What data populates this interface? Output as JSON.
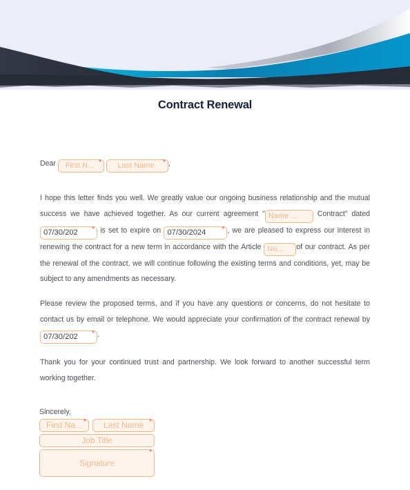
{
  "document": {
    "title": "Contract Renewal",
    "greeting": {
      "prefix": "Dear",
      "first_name_placeholder": "First N...",
      "last_name_placeholder": "Last Name",
      "suffix": ","
    },
    "paragraph1": {
      "text_a": "I hope this letter finds you well. We greatly value our ongoing business relationship and the mutual success we have achieved together. As our current agreement \"",
      "agreement_name_placeholder": "Name ...",
      "text_b": "Contract\" dated",
      "dated_value": "07/30/202",
      "text_c": "is set to expire on",
      "expire_value": "07/30/2024",
      "text_d": ", we are pleased to express our interest in renewing the contract for a new term in accordance with the Article",
      "article_placeholder": "Nu...",
      "text_e": "of our contract. As per the renewal of the contract, we will continue following the existing terms and conditions, yet, may be subject to any amendments as necessary."
    },
    "paragraph2": {
      "text_a": "Please review the proposed terms, and if you have any questions or concerns, do not hesitate to contact us by email or telephone. We would appreciate your confirmation of the contract renewal by",
      "by_date_value": "07/30/202",
      "text_b": "."
    },
    "paragraph3": {
      "text": "Thank you for your continued trust and partnership. We look forward to another successful term working together."
    },
    "closing": {
      "label": "Sincerely,",
      "first_name_placeholder": "First Na...",
      "last_name_placeholder": "Last Name",
      "job_title_placeholder": "Job Title",
      "signature_placeholder": "Signature"
    },
    "required_marker": "*"
  },
  "colors": {
    "banner_background": "#ebedf8",
    "banner_dark": "#2a2f3c",
    "banner_blue": "#0693c9",
    "banner_cyan": "#0bb6e0",
    "field_border": "#f6b584",
    "field_fill": "#fff4eb",
    "field_placeholder": "#f8b88a",
    "required": "#ea4f52",
    "title": "#17203a",
    "body_text": "#4a4f57"
  }
}
